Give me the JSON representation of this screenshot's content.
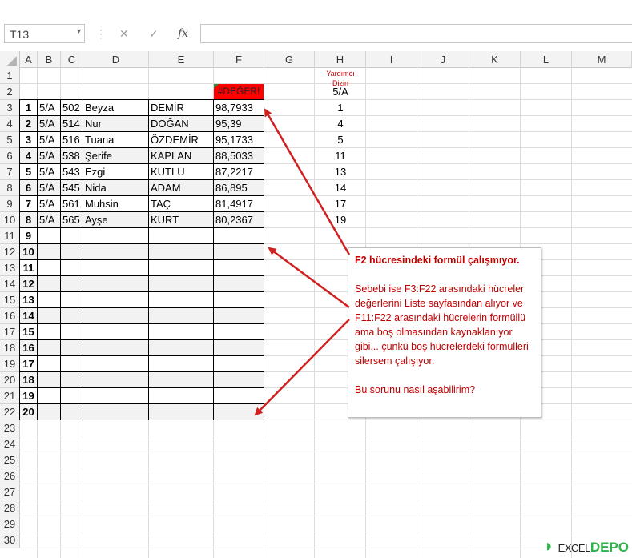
{
  "formula_bar": {
    "name_box": "T13",
    "name_box_arrow": "▾",
    "cancel_icon": "✕",
    "enter_icon": "✓",
    "fx_icon": "fx",
    "formula": ""
  },
  "columns": [
    "A",
    "B",
    "C",
    "D",
    "E",
    "F",
    "G",
    "H",
    "I",
    "J",
    "K",
    "L",
    "M"
  ],
  "rows": [
    "1",
    "2",
    "3",
    "4",
    "5",
    "6",
    "7",
    "8",
    "9",
    "10",
    "11",
    "12",
    "13",
    "14",
    "15",
    "16",
    "17",
    "18",
    "19",
    "20",
    "21",
    "22",
    "23",
    "24",
    "25",
    "26",
    "27",
    "28",
    "29",
    "30"
  ],
  "helper": {
    "line1": "Yardımcı",
    "line2": "Dizin",
    "value_h2": "5/A",
    "values": [
      "1",
      "4",
      "5",
      "11",
      "13",
      "14",
      "17",
      "19"
    ]
  },
  "error_cell": "#DEĞER!",
  "table": {
    "rows": [
      {
        "a": "1",
        "b": "5/A",
        "c": "502",
        "d": "Beyza",
        "e": "DEMİR",
        "f": "98,7933"
      },
      {
        "a": "2",
        "b": "5/A",
        "c": "514",
        "d": "Nur",
        "e": "DOĞAN",
        "f": "95,39"
      },
      {
        "a": "3",
        "b": "5/A",
        "c": "516",
        "d": "Tuana",
        "e": "ÖZDEMİR",
        "f": "95,1733"
      },
      {
        "a": "4",
        "b": "5/A",
        "c": "538",
        "d": "Şerife",
        "e": "KAPLAN",
        "f": "88,5033"
      },
      {
        "a": "5",
        "b": "5/A",
        "c": "543",
        "d": "Ezgi",
        "e": "KUTLU",
        "f": "87,2217"
      },
      {
        "a": "6",
        "b": "5/A",
        "c": "545",
        "d": "Nida",
        "e": "ADAM",
        "f": "86,895"
      },
      {
        "a": "7",
        "b": "5/A",
        "c": "561",
        "d": "Muhsin",
        "e": "TAÇ",
        "f": "81,4917"
      },
      {
        "a": "8",
        "b": "5/A",
        "c": "565",
        "d": "Ayşe",
        "e": "KURT",
        "f": "80,2367"
      }
    ],
    "empty_numbers": [
      "9",
      "10",
      "11",
      "12",
      "13",
      "14",
      "15",
      "16",
      "17",
      "18",
      "19",
      "20"
    ]
  },
  "callout": {
    "title": "F2 hücresindeki formül çalışmıyor.",
    "body": "Sebebi ise F3:F22 arasındaki hücreler değerlerini Liste sayfasından alıyor ve F11:F22 arasındaki hücrelerin formüllü ama boş olmasından kaynaklanıyor gibi... çünkü boş hücrelerdeki formülleri silersem çalışıyor.",
    "question": "Bu sorunu nasıl aşabilirim?"
  },
  "watermark": {
    "part1": "EXCEL",
    "part2": "DEPO"
  },
  "colors": {
    "error_fill": "#ff0000",
    "callout_text": "#c00000",
    "arrow": "#d02020",
    "row_shade": "#f2f2f2"
  }
}
